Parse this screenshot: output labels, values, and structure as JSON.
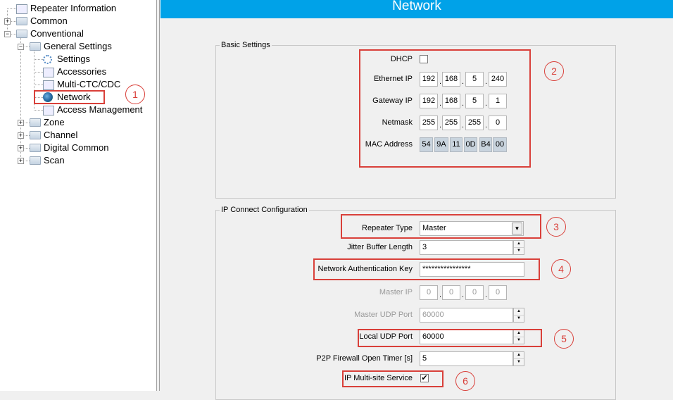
{
  "tree": {
    "items": [
      {
        "label": "Repeater Information",
        "icon": "document-icon"
      },
      {
        "label": "Common",
        "icon": "folder-icon",
        "expander": "+"
      },
      {
        "label": "Conventional",
        "icon": "folder-icon",
        "expander": "-"
      },
      {
        "label": "General Settings",
        "icon": "folder-icon",
        "expander": "-"
      },
      {
        "label": "Settings",
        "icon": "gear-icon"
      },
      {
        "label": "Accessories",
        "icon": "accessories-icon"
      },
      {
        "label": "Multi-CTC/CDC",
        "icon": "multi-ctc-icon"
      },
      {
        "label": "Network",
        "icon": "globe-icon",
        "selected": true
      },
      {
        "label": "Access Management",
        "icon": "access-management-icon"
      },
      {
        "label": "Zone",
        "icon": "folder-icon",
        "expander": "+"
      },
      {
        "label": "Channel",
        "icon": "folder-icon",
        "expander": "+"
      },
      {
        "label": "Digital Common",
        "icon": "folder-icon",
        "expander": "+"
      },
      {
        "label": "Scan",
        "icon": "folder-icon",
        "expander": "+"
      }
    ]
  },
  "header": {
    "title": "Network",
    "color": "#00a2e8"
  },
  "basic": {
    "title": "Basic Settings",
    "dhcp": {
      "label": "DHCP",
      "checked": false
    },
    "ethernet_ip": {
      "label": "Ethernet IP",
      "octets": [
        "192",
        "168",
        "5",
        "240"
      ]
    },
    "gateway_ip": {
      "label": "Gateway IP",
      "octets": [
        "192",
        "168",
        "5",
        "1"
      ]
    },
    "netmask": {
      "label": "Netmask",
      "octets": [
        "255",
        "255",
        "255",
        "0"
      ]
    },
    "mac": {
      "label": "MAC Address",
      "bytes": [
        "54",
        "9A",
        "11",
        "0D",
        "B4",
        "00"
      ]
    }
  },
  "ipconf": {
    "title": "IP Connect Configuration",
    "repeater_type": {
      "label": "Repeater Type",
      "value": "Master"
    },
    "jitter": {
      "label": "Jitter Buffer Length",
      "value": "3"
    },
    "auth_key": {
      "label": "Network Authentication Key",
      "value": "****************"
    },
    "master_ip": {
      "label": "Master IP",
      "octets": [
        "0",
        "0",
        "0",
        "0"
      ]
    },
    "master_udp": {
      "label": "Master UDP Port",
      "value": "60000"
    },
    "local_udp": {
      "label": "Local UDP Port",
      "value": "60000"
    },
    "p2p": {
      "label": "P2P Firewall Open Timer [s]",
      "value": "5"
    },
    "multisite": {
      "label": "IP Multi-site Service",
      "checked": true
    }
  },
  "annotations": [
    "1",
    "2",
    "3",
    "4",
    "5",
    "6"
  ],
  "annotation_color": "#d9403a"
}
